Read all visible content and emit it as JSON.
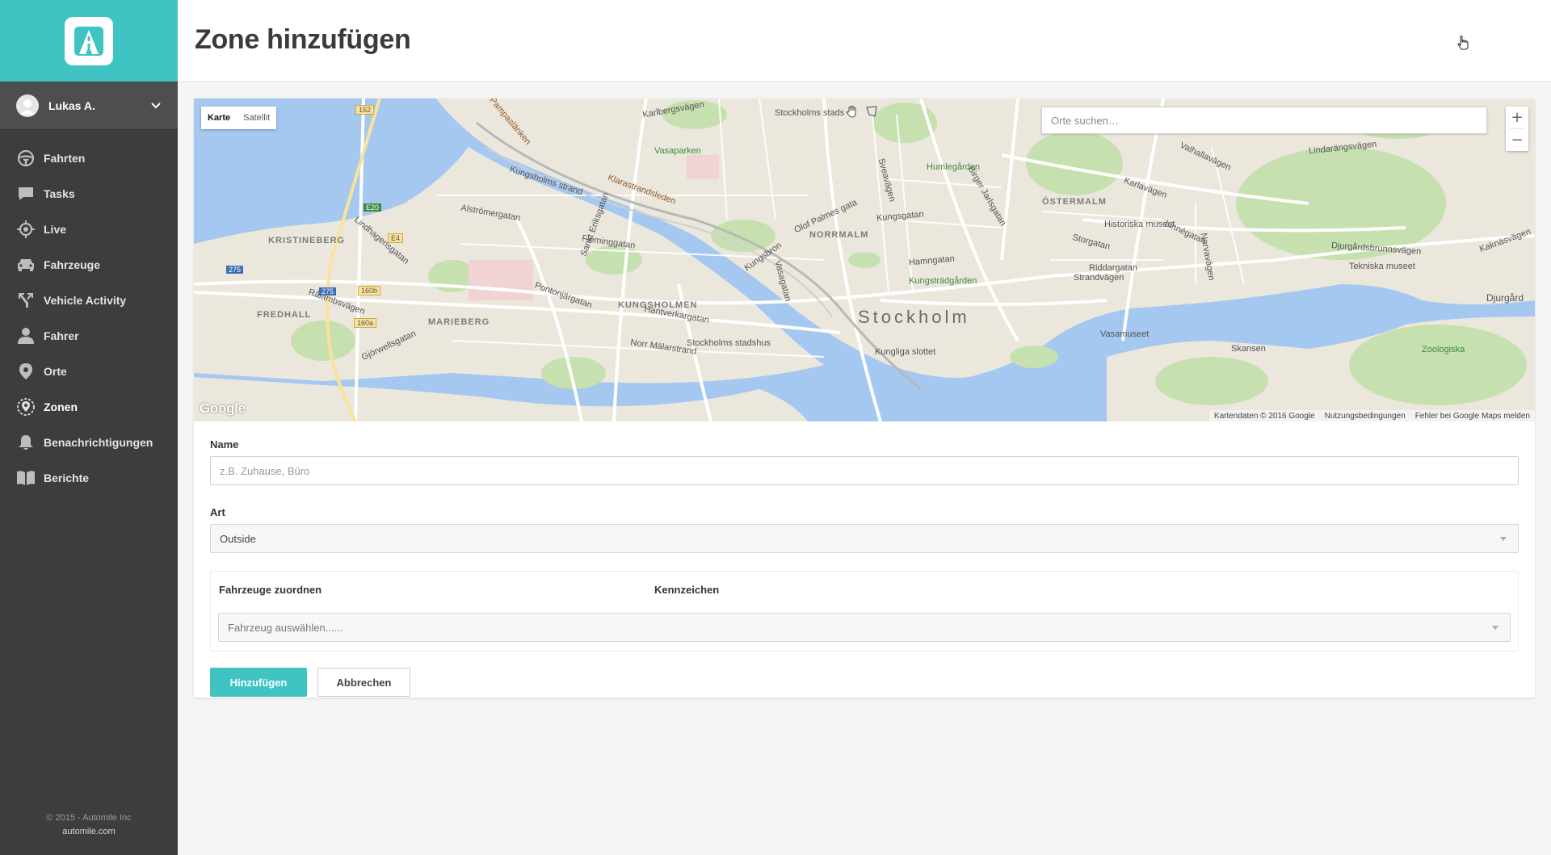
{
  "app": {
    "brand_color": "#3fc3c3",
    "sidebar_color": "#3d3d3d"
  },
  "user": {
    "name": "Lukas A."
  },
  "nav": {
    "items": [
      {
        "label": "Fahrten",
        "icon": "steering-wheel-icon"
      },
      {
        "label": "Tasks",
        "icon": "chat-bubble-icon"
      },
      {
        "label": "Live",
        "icon": "crosshair-icon"
      },
      {
        "label": "Fahrzeuge",
        "icon": "car-icon"
      },
      {
        "label": "Vehicle Activity",
        "icon": "route-icon"
      },
      {
        "label": "Fahrer",
        "icon": "person-icon"
      },
      {
        "label": "Orte",
        "icon": "map-pin-icon"
      },
      {
        "label": "Zonen",
        "icon": "zone-pin-icon",
        "active": true
      },
      {
        "label": "Benachrichtigungen",
        "icon": "bell-icon"
      },
      {
        "label": "Berichte",
        "icon": "book-icon"
      }
    ]
  },
  "footer": {
    "copyright": "© 2015 - Automile Inc",
    "link": "automile.com"
  },
  "header": {
    "title": "Zone hinzufügen"
  },
  "map": {
    "type_map": "Karte",
    "type_satellite": "Satellit",
    "search_placeholder": "Orte suchen…",
    "zoom_in": "+",
    "zoom_out": "−",
    "logo": "Google",
    "attribution": {
      "data": "Kartendaten © 2016 Google",
      "terms": "Nutzungsbedingungen",
      "report": "Fehler bei Google Maps melden"
    },
    "labels": {
      "kristineberg": "KRISTINEBERG",
      "kungsholmen": "KUNGSHOLMEN",
      "normalm": "NORRMALM",
      "ostermalm": "ÖSTERMALM",
      "marieberg": "MARIEBERG",
      "fredhall": "FREDHALL",
      "stockholm": "Stockholm",
      "humlegarden": "Humlegården",
      "kungstradgarden": "Kungsträdgården",
      "vasaparken": "Vasaparken",
      "klarastrandsleden": "Klarastrandsleden",
      "kungsholms_strand": "Kungsholms strand",
      "historiska": "Historiska museet",
      "tekniska": "Tekniska museet",
      "vasamuseet": "Vasamuseet",
      "skansen": "Skansen",
      "stadshus": "Stockholms stadshus",
      "kungliga": "Kungliga slottet",
      "norr_malarstrand": "Norr Mälarstrand",
      "hantverkargatan": "Hantverkargatan",
      "fleminggatan": "Fleminggatan",
      "kungsgatan": "Kungsgatan",
      "hamngatan": "Hamngatan",
      "strandvagen": "Strandvägen",
      "karlavagen": "Karlavägen",
      "valhallavagen": "Valhallavägen",
      "lindarangsvagen": "Lindarängsvägen",
      "djurgardsbrunnsvagen": "Djurgårdsbrunnsvägen",
      "stockholms_stads": "Stockholms stads",
      "karlbergsvagen": "Karlbergsvägen",
      "rålambsvagen": "Rålambsvägen",
      "pampaslanken": "Pampaslänken",
      "djurgard": "Djurgård",
      "riddargatan": "Riddargatan",
      "storgatan": "Storgatan",
      "olof_palmes": "Olof Palmes gata",
      "birger_jarlsgatan": "Birger Jarlsgatan",
      "alstromergatan": "Alströmergatan",
      "pontonjargatan": "Pontonjärgatan",
      "gjorwellsgatan": "Gjörwellsgatan",
      "lindhagensgatan": "Lindhagensgatan",
      "sankt_eriksgatan": "Sankt Eriksgatan",
      "kungsbron": "Kungsbron",
      "vasagatan": "Vasagatan",
      "sveavagen": "Sveavägen",
      "narvavagen": "Narvavägen",
      "linnegatan": "Linnégatan",
      "kaknasvagen": "Kaknäsvägen",
      "zinkensdamm": "Zoologiska",
      "r162": "162",
      "e20": "E20",
      "e4": "E4",
      "r275a": "275",
      "r275b": "275",
      "r160b": "160b",
      "r160a": "160a"
    }
  },
  "form": {
    "name_label": "Name",
    "name_placeholder": "z.B. Zuhause, Büro",
    "name_value": "",
    "type_label": "Art",
    "type_value": "Outside",
    "assign_label": "Fahrzeuge zuordnen",
    "plate_label": "Kennzeichen",
    "vehicle_placeholder": "Fahrzeug auswählen......",
    "submit_label": "Hinzufügen",
    "cancel_label": "Abbrechen"
  }
}
